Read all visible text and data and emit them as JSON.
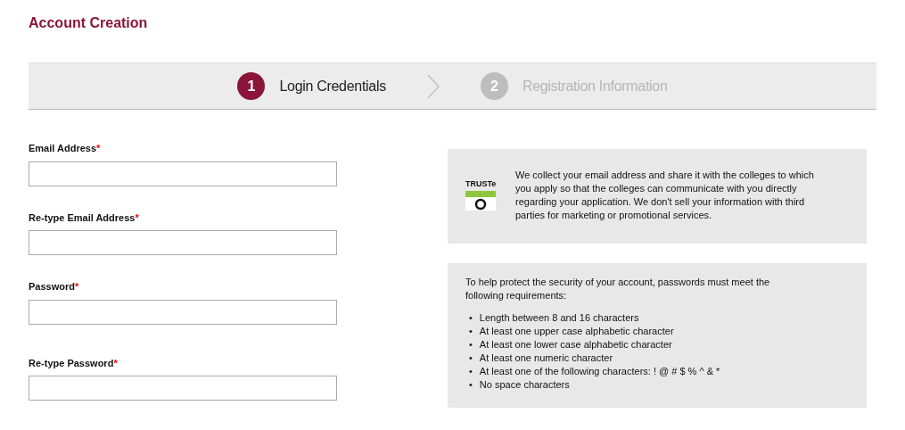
{
  "page": {
    "title": "Account Creation"
  },
  "steps": [
    {
      "number": "1",
      "label": "Login Credentials",
      "selected": true
    },
    {
      "number": "2",
      "label": "Registration Information",
      "selected": false
    }
  ],
  "fields": [
    {
      "label": "Email Address",
      "required": true,
      "required_mark": "*"
    },
    {
      "label": "Re-type Email Address",
      "required": true,
      "required_mark": "*"
    },
    {
      "label": "Password",
      "required": true,
      "required_mark": "*"
    },
    {
      "label": "Re-type Password",
      "required": true,
      "required_mark": "*"
    }
  ],
  "privacy": {
    "badge": "TRUSTe",
    "text": "We collect your email address and share it with the colleges to which you apply so that the colleges can communicate with you directly regarding your application. We don't sell your information with third parties for marketing or promotional services."
  },
  "password_rules": {
    "intro": "To help protect the security of your account, passwords must meet the following requirements:",
    "bullet": "•",
    "items": [
      "Length between 8 and 16 characters",
      "At least one upper case alphabetic character",
      "At least one lower case alphabetic character",
      "At least one numeric character",
      "At least one of the following characters: ! @ # $ % ^ & *",
      "No space characters"
    ]
  }
}
